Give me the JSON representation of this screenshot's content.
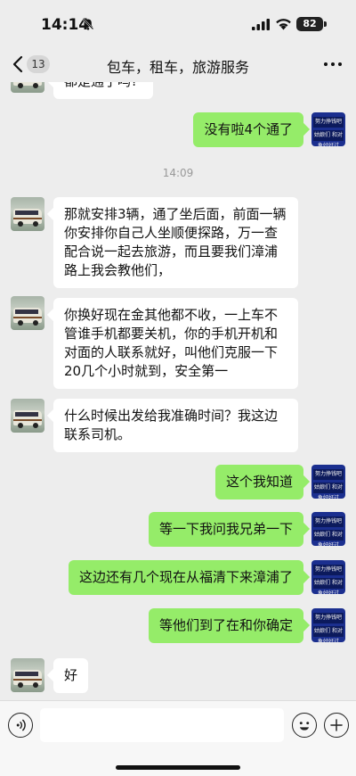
{
  "status_bar": {
    "time": "14:14",
    "battery": "82"
  },
  "nav": {
    "back_count": "13",
    "title": "包车，租车，旅游服务"
  },
  "chat": {
    "partial_message": "都是通了吗?",
    "self_avatar_text": [
      "努力挣钱吧",
      "姑娘们 和对象好好过"
    ],
    "messages": [
      {
        "side": "out",
        "text": "没有啦4个通了"
      },
      {
        "side": "time",
        "text": "14:09"
      },
      {
        "side": "in",
        "text": "那就安排3辆，通了坐后面，前面一辆你安排你自己人坐顺便探路，万一查配合说一起去旅游，而且要我们漳浦路上我会教他们，"
      },
      {
        "side": "in",
        "text": "你换好现在金其他都不收，一上车不管谁手机都要关机，你的手机开机和对面的人联系就好，叫他们克服一下20几个小时就到，安全第一"
      },
      {
        "side": "in",
        "text": "什么时候出发给我准确时间？我这边联系司机。"
      },
      {
        "side": "out",
        "text": "这个我知道"
      },
      {
        "side": "out",
        "text": "等一下我问我兄弟一下"
      },
      {
        "side": "out",
        "text": "这边还有几个现在从福清下来漳浦了"
      },
      {
        "side": "out",
        "text": "等他们到了在和你确定"
      },
      {
        "side": "in",
        "text": "好"
      }
    ]
  },
  "icons": {
    "back": "chevron-left-icon",
    "more": "more-dots-icon",
    "voice": "voice-icon",
    "emoji": "emoji-icon",
    "plus": "plus-icon",
    "muted": "bell-slash-icon"
  },
  "colors": {
    "background": "#ededed",
    "outgoing_bubble": "#95ec69",
    "incoming_bubble": "#ffffff"
  }
}
